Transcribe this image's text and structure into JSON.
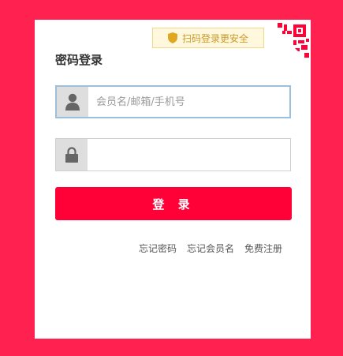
{
  "login": {
    "title": "密码登录",
    "qr_tip": "扫码登录更安全",
    "username_placeholder": "会员名/邮箱/手机号",
    "username_value": "",
    "password_value": "",
    "login_button": "登 录",
    "links": {
      "forgot_password": "忘记密码",
      "forgot_username": "忘记会员名",
      "register": "免费注册"
    }
  },
  "colors": {
    "background": "#ff2150",
    "button": "#ff0037",
    "tip_text": "#c89a2a"
  },
  "icons": [
    "shield-icon",
    "qr-code-icon",
    "user-icon",
    "lock-icon"
  ]
}
